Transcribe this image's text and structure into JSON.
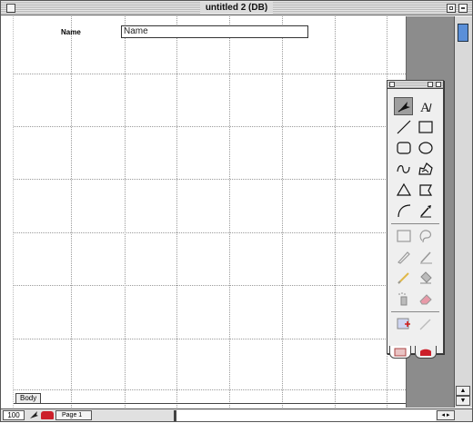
{
  "window": {
    "title": "untitled 2 (DB)"
  },
  "layout": {
    "field_label": "Name",
    "field_value": "Name",
    "body_part_label": "Body"
  },
  "status": {
    "zoom": "100",
    "page_label": "Page 1"
  },
  "colors": {
    "accent_blue": "#5a8fd8",
    "red_icon": "#cc1f2a",
    "gray_pasteboard": "#8c8c8c"
  },
  "palette": {
    "tools": [
      "pointer-tool-icon",
      "text-tool-icon",
      "line-tool-icon",
      "rectangle-tool-icon",
      "rounded-rect-tool-icon",
      "oval-tool-icon",
      "freehand-tool-icon",
      "freeform-shape-tool-icon",
      "triangle-tool-icon",
      "polygon-tool-icon",
      "arc-tool-icon",
      "eyedropper-tool-icon",
      "marquee-select-icon",
      "lasso-select-icon",
      "pencil-tool-icon",
      "brush-tool-icon",
      "paint-brush-tool-icon",
      "paint-bucket-tool-icon",
      "spray-tool-icon",
      "eraser-tool-icon",
      "insert-field-icon",
      "disabled-line-icon"
    ],
    "tabs": [
      "layout-tab-icon",
      "shapes-tab-icon"
    ]
  }
}
